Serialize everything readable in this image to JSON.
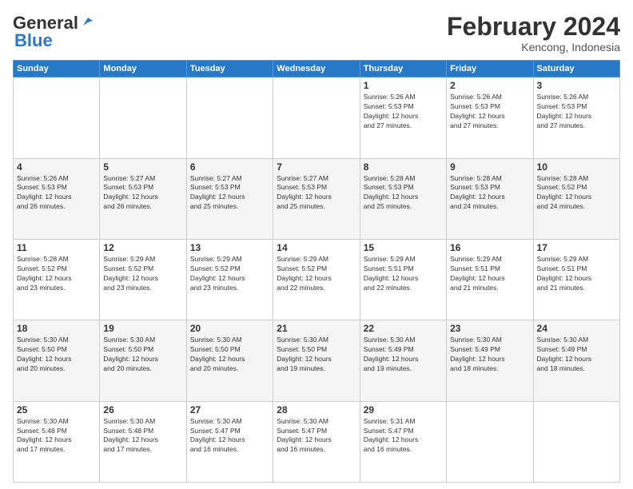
{
  "header": {
    "logo_general": "General",
    "logo_blue": "Blue",
    "month_title": "February 2024",
    "location": "Kencong, Indonesia"
  },
  "weekdays": [
    "Sunday",
    "Monday",
    "Tuesday",
    "Wednesday",
    "Thursday",
    "Friday",
    "Saturday"
  ],
  "weeks": [
    [
      {
        "date": "",
        "info": ""
      },
      {
        "date": "",
        "info": ""
      },
      {
        "date": "",
        "info": ""
      },
      {
        "date": "",
        "info": ""
      },
      {
        "date": "1",
        "info": "Sunrise: 5:26 AM\nSunset: 5:53 PM\nDaylight: 12 hours\nand 27 minutes."
      },
      {
        "date": "2",
        "info": "Sunrise: 5:26 AM\nSunset: 5:53 PM\nDaylight: 12 hours\nand 27 minutes."
      },
      {
        "date": "3",
        "info": "Sunrise: 5:26 AM\nSunset: 5:53 PM\nDaylight: 12 hours\nand 27 minutes."
      }
    ],
    [
      {
        "date": "4",
        "info": "Sunrise: 5:26 AM\nSunset: 5:53 PM\nDaylight: 12 hours\nand 26 minutes."
      },
      {
        "date": "5",
        "info": "Sunrise: 5:27 AM\nSunset: 5:53 PM\nDaylight: 12 hours\nand 26 minutes."
      },
      {
        "date": "6",
        "info": "Sunrise: 5:27 AM\nSunset: 5:53 PM\nDaylight: 12 hours\nand 25 minutes."
      },
      {
        "date": "7",
        "info": "Sunrise: 5:27 AM\nSunset: 5:53 PM\nDaylight: 12 hours\nand 25 minutes."
      },
      {
        "date": "8",
        "info": "Sunrise: 5:28 AM\nSunset: 5:53 PM\nDaylight: 12 hours\nand 25 minutes."
      },
      {
        "date": "9",
        "info": "Sunrise: 5:28 AM\nSunset: 5:53 PM\nDaylight: 12 hours\nand 24 minutes."
      },
      {
        "date": "10",
        "info": "Sunrise: 5:28 AM\nSunset: 5:52 PM\nDaylight: 12 hours\nand 24 minutes."
      }
    ],
    [
      {
        "date": "11",
        "info": "Sunrise: 5:28 AM\nSunset: 5:52 PM\nDaylight: 12 hours\nand 23 minutes."
      },
      {
        "date": "12",
        "info": "Sunrise: 5:29 AM\nSunset: 5:52 PM\nDaylight: 12 hours\nand 23 minutes."
      },
      {
        "date": "13",
        "info": "Sunrise: 5:29 AM\nSunset: 5:52 PM\nDaylight: 12 hours\nand 23 minutes."
      },
      {
        "date": "14",
        "info": "Sunrise: 5:29 AM\nSunset: 5:52 PM\nDaylight: 12 hours\nand 22 minutes."
      },
      {
        "date": "15",
        "info": "Sunrise: 5:29 AM\nSunset: 5:51 PM\nDaylight: 12 hours\nand 22 minutes."
      },
      {
        "date": "16",
        "info": "Sunrise: 5:29 AM\nSunset: 5:51 PM\nDaylight: 12 hours\nand 21 minutes."
      },
      {
        "date": "17",
        "info": "Sunrise: 5:29 AM\nSunset: 5:51 PM\nDaylight: 12 hours\nand 21 minutes."
      }
    ],
    [
      {
        "date": "18",
        "info": "Sunrise: 5:30 AM\nSunset: 5:50 PM\nDaylight: 12 hours\nand 20 minutes."
      },
      {
        "date": "19",
        "info": "Sunrise: 5:30 AM\nSunset: 5:50 PM\nDaylight: 12 hours\nand 20 minutes."
      },
      {
        "date": "20",
        "info": "Sunrise: 5:30 AM\nSunset: 5:50 PM\nDaylight: 12 hours\nand 20 minutes."
      },
      {
        "date": "21",
        "info": "Sunrise: 5:30 AM\nSunset: 5:50 PM\nDaylight: 12 hours\nand 19 minutes."
      },
      {
        "date": "22",
        "info": "Sunrise: 5:30 AM\nSunset: 5:49 PM\nDaylight: 12 hours\nand 19 minutes."
      },
      {
        "date": "23",
        "info": "Sunrise: 5:30 AM\nSunset: 5:49 PM\nDaylight: 12 hours\nand 18 minutes."
      },
      {
        "date": "24",
        "info": "Sunrise: 5:30 AM\nSunset: 5:49 PM\nDaylight: 12 hours\nand 18 minutes."
      }
    ],
    [
      {
        "date": "25",
        "info": "Sunrise: 5:30 AM\nSunset: 5:48 PM\nDaylight: 12 hours\nand 17 minutes."
      },
      {
        "date": "26",
        "info": "Sunrise: 5:30 AM\nSunset: 5:48 PM\nDaylight: 12 hours\nand 17 minutes."
      },
      {
        "date": "27",
        "info": "Sunrise: 5:30 AM\nSunset: 5:47 PM\nDaylight: 12 hours\nand 16 minutes."
      },
      {
        "date": "28",
        "info": "Sunrise: 5:30 AM\nSunset: 5:47 PM\nDaylight: 12 hours\nand 16 minutes."
      },
      {
        "date": "29",
        "info": "Sunrise: 5:31 AM\nSunset: 5:47 PM\nDaylight: 12 hours\nand 16 minutes."
      },
      {
        "date": "",
        "info": ""
      },
      {
        "date": "",
        "info": ""
      }
    ]
  ]
}
